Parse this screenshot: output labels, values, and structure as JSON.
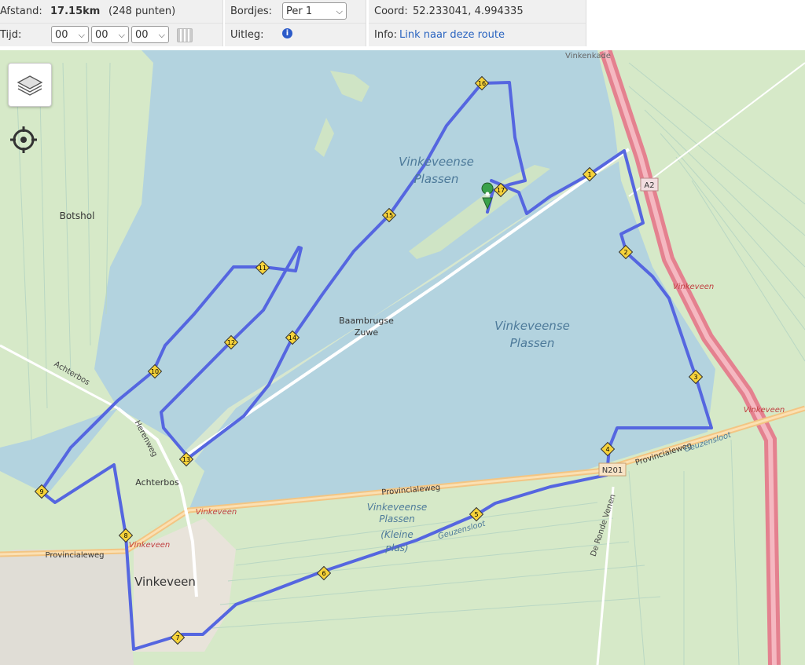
{
  "info_panel": {
    "distance_label": "Afstand:",
    "distance_value": "17.15km",
    "points": "(248 punten)",
    "time_label": "Tijd:",
    "time_hours": "00",
    "time_minutes": "00",
    "time_seconds": "00",
    "signs_label": "Bordjes:",
    "signs_value": "Per 1",
    "explain_label": "Uitleg:",
    "coord_label": "Coord:",
    "coord_value": "52.233041, 4.994335",
    "info_label": "Info:",
    "info_link": "Link naar deze route"
  },
  "map": {
    "layers_icon": "layers-icon",
    "locate_icon": "crosshair-icon",
    "route_color": "#5566e0",
    "water_color": "#b3d3df",
    "land_color": "#d6e9c8",
    "labels": {
      "vinkenkade": "Vinkenkade",
      "lake_north_1": "Vinkeveense",
      "lake_north_2": "Plassen",
      "botshol": "Botshol",
      "a2": "A2",
      "vinkeveen_east": "Vinkeveen",
      "baambrugse_1": "Baambrugse",
      "baambrugse_2": "Zuwe",
      "lake_south_1": "Vinkeveense",
      "lake_south_2": "Plassen",
      "achterbos_road": "Achterbos",
      "herenweg": "Herenweg",
      "achterbos": "Achterbos",
      "vinkeveen_center": "Vinkeveen",
      "vinkeveen_red": "Vinkeveen",
      "vinkeveen_red2": "Vinkeveen",
      "provincialeweg_1": "Provincialeweg",
      "provincialeweg_2": "Provincialeweg",
      "provincialeweg_3": "Provincialeweg",
      "n201": "N201",
      "geuzensloot_1": "Geuzensloot",
      "geuzensloot_2": "Geuzensloot",
      "kleine_1": "Vinkeveense",
      "kleine_2": "Plassen",
      "kleine_3": "(Kleine",
      "kleine_4": "plas)",
      "ronde_venen": "De Ronde Venen",
      "vinkeveen_exit": "Vinkeveen"
    },
    "markers": [
      "1",
      "2",
      "3",
      "4",
      "5",
      "6",
      "7",
      "8",
      "9",
      "10",
      "11",
      "12",
      "13",
      "14",
      "15",
      "16",
      "17"
    ]
  }
}
